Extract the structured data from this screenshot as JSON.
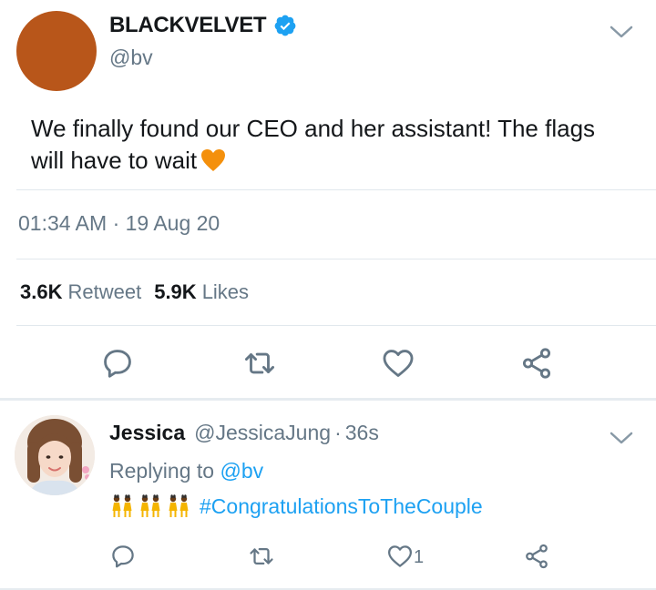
{
  "tweet": {
    "display_name": "BLACKVELVET",
    "handle": "@bv",
    "verified_icon": "verified-badge-icon",
    "text": "We finally found our CEO and her assistant! The flags will have to wait",
    "emoji": "orange-heart-icon",
    "timestamp": "01:34 AM · 19 Aug 20",
    "retweets_count": "3.6K",
    "retweets_label": "Retweet",
    "likes_count": "5.9K",
    "likes_label": "Likes",
    "actions": [
      "reply-icon",
      "retweet-icon",
      "like-icon",
      "share-icon"
    ]
  },
  "reply": {
    "display_name": "Jessica",
    "handle": "@JessicaJung",
    "separator": "·",
    "time": "36s",
    "replying_prefix": "Replying to",
    "replying_to": "@bv",
    "emojis": [
      "dancers-icon",
      "dancers-icon",
      "dancers-icon"
    ],
    "hashtag": "#CongratulationsToTheCouple",
    "like_count": "1",
    "actions": [
      "reply-icon",
      "retweet-icon",
      "like-icon",
      "share-icon"
    ]
  },
  "colors": {
    "link": "#1da1f2",
    "secondary_text": "#657786",
    "verified": "#1da1f2",
    "avatar_main": "#b8561a",
    "heart_emoji": "#f4900c"
  }
}
